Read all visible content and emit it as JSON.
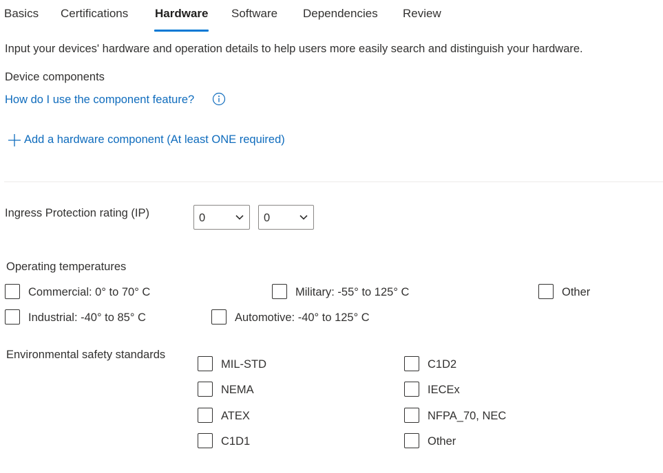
{
  "tabs": [
    {
      "label": "Basics"
    },
    {
      "label": "Certifications"
    },
    {
      "label": "Hardware",
      "active": true
    },
    {
      "label": "Software"
    },
    {
      "label": "Dependencies"
    },
    {
      "label": "Review"
    }
  ],
  "description": "Input your devices' hardware and operation details to help users more easily search and distinguish your hardware.",
  "device_components": {
    "heading": "Device components",
    "help_link": "How do I use the component feature?",
    "add_link": "Add a hardware component (At least ONE required)"
  },
  "ip_rating": {
    "label": "Ingress Protection rating (IP)",
    "first_value": "0",
    "second_value": "0"
  },
  "operating_temperatures": {
    "label": "Operating temperatures",
    "options": [
      {
        "label": "Commercial: 0° to 70° C",
        "checked": false
      },
      {
        "label": "Military: -55° to 125° C",
        "checked": false
      },
      {
        "label": "Other",
        "checked": false
      },
      {
        "label": "Industrial: -40° to 85° C",
        "checked": false
      },
      {
        "label": "Automotive: -40° to 125° C",
        "checked": false
      }
    ]
  },
  "environmental_standards": {
    "label": "Environmental safety standards",
    "options": [
      {
        "label": "MIL-STD",
        "checked": false
      },
      {
        "label": "NEMA",
        "checked": false
      },
      {
        "label": "ATEX",
        "checked": false
      },
      {
        "label": "C1D1",
        "checked": false
      },
      {
        "label": "C1D2",
        "checked": false
      },
      {
        "label": "IECEx",
        "checked": false
      },
      {
        "label": "NFPA_70, NEC",
        "checked": false
      },
      {
        "label": "Other",
        "checked": false
      }
    ]
  },
  "colors": {
    "accent": "#0078d4",
    "link": "#0f6cbd",
    "text": "#323130",
    "divider": "#edebe9"
  },
  "icons": {
    "info": "info-circle-icon",
    "add": "plus-icon",
    "dropdown": "chevron-down-icon"
  }
}
